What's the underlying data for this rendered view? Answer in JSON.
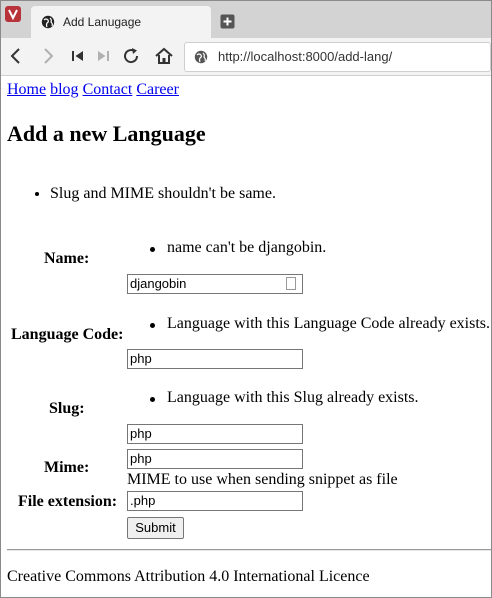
{
  "browser": {
    "tab_title": "Add Lanugage",
    "url": "http://localhost:8000/add-lang/",
    "icons": [
      "vivaldi-icon",
      "globe-icon",
      "new-tab-icon",
      "back-icon",
      "forward-icon",
      "rewind-icon",
      "fast-forward-icon",
      "reload-icon",
      "home-icon"
    ]
  },
  "nav": {
    "home": "Home",
    "blog": "blog",
    "contact": "Contact",
    "career": "Career"
  },
  "page_title": "Add a new Language",
  "form_errors": [
    "Slug and MIME shouldn't be same."
  ],
  "fields": {
    "name": {
      "label": "Name:",
      "error": "name can't be djangobin.",
      "value": "djangobin"
    },
    "language_code": {
      "label": "Language Code:",
      "error": "Language with this Language Code already exists.",
      "value": "php"
    },
    "slug": {
      "label": "Slug:",
      "error": "Language with this Slug already exists.",
      "value": "php"
    },
    "mime": {
      "label": "Mime:",
      "value": "php",
      "help": "MIME to use when sending snippet as file"
    },
    "file_extension": {
      "label": "File extension:",
      "value": ".php"
    }
  },
  "submit_label": "Submit",
  "footer": "Creative Commons Attribution 4.0 International Licence"
}
